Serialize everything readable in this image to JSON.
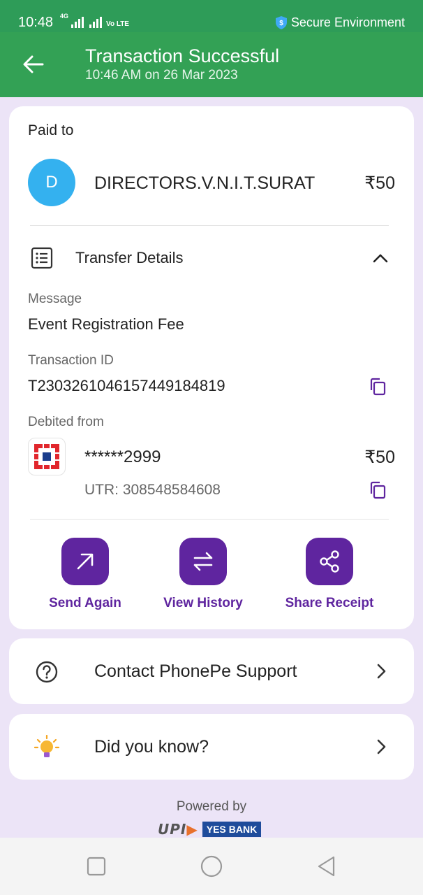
{
  "status_bar": {
    "time": "10:48",
    "network_tag": "4G",
    "lte_tag": "Vo LTE",
    "secure_text": "Secure Environment"
  },
  "header": {
    "title": "Transaction Successful",
    "subtitle": "10:46 AM on 26 Mar 2023"
  },
  "paid_to": {
    "label": "Paid to",
    "avatar_letter": "D",
    "name": "DIRECTORS.V.N.I.T.SURAT",
    "amount": "₹50"
  },
  "transfer_details": {
    "title": "Transfer Details",
    "message_label": "Message",
    "message_value": "Event Registration Fee",
    "txn_id_label": "Transaction ID",
    "txn_id_value": "T2303261046157449184819",
    "debited_label": "Debited from",
    "account_masked": "******2999",
    "debited_amount": "₹50",
    "utr": "UTR: 308548584608"
  },
  "actions": [
    {
      "label": "Send Again",
      "icon": "arrow-up-right-icon"
    },
    {
      "label": "View History",
      "icon": "swap-arrows-icon"
    },
    {
      "label": "Share Receipt",
      "icon": "share-icon"
    }
  ],
  "support": {
    "label": "Contact PhonePe Support"
  },
  "did_you_know": {
    "label": "Did you know?"
  },
  "footer": {
    "powered_by": "Powered by",
    "upi_logo": "UPI",
    "bank_yes": "YES",
    "bank_name": "BANK"
  },
  "colors": {
    "header_green": "#33a155",
    "brand_purple": "#5f259f",
    "page_background": "#ece4f7",
    "avatar_blue": "#34b1ef"
  }
}
